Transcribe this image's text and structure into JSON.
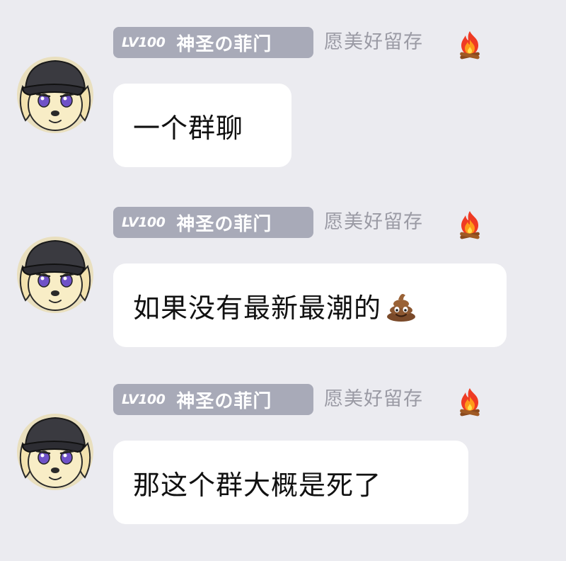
{
  "messages": [
    {
      "sender": {
        "level": "LV100",
        "name": "神圣の菲门",
        "title": "愿美好留存",
        "title_icon": "fire-icon"
      },
      "text": "一个群聊",
      "trailing_icon": null
    },
    {
      "sender": {
        "level": "LV100",
        "name": "神圣の菲门",
        "title": "愿美好留存",
        "title_icon": "fire-icon"
      },
      "text": "如果没有最新最潮的",
      "trailing_icon": "poop-icon"
    },
    {
      "sender": {
        "level": "LV100",
        "name": "神圣の菲门",
        "title": "愿美好留存",
        "title_icon": "fire-icon"
      },
      "text": "那这个群大概是死了",
      "trailing_icon": null
    }
  ],
  "colors": {
    "background": "#ebebf0",
    "badge": "#a8aab8",
    "bubble": "#ffffff",
    "title_text": "#9a9aa4"
  }
}
